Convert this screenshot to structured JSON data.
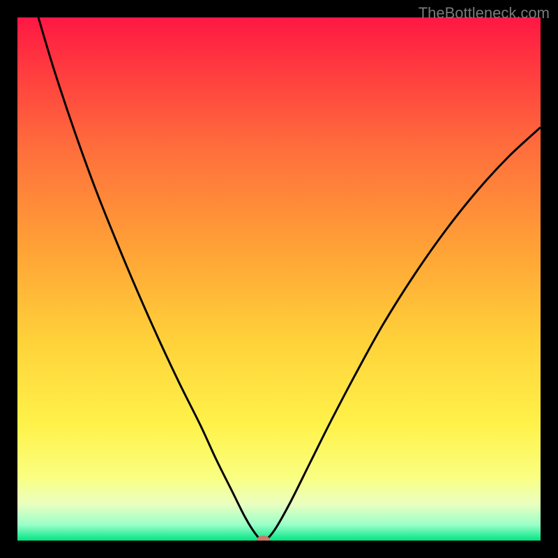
{
  "watermark": "TheBottleneck.com",
  "chart_data": {
    "type": "line",
    "title": "",
    "xlabel": "",
    "ylabel": "",
    "xlim": [
      0,
      100
    ],
    "ylim": [
      0,
      100
    ],
    "background_gradient": {
      "stops": [
        {
          "offset": 0.0,
          "color": "#ff1744"
        },
        {
          "offset": 0.1,
          "color": "#ff3b3f"
        },
        {
          "offset": 0.25,
          "color": "#ff6e3c"
        },
        {
          "offset": 0.45,
          "color": "#ffa436"
        },
        {
          "offset": 0.62,
          "color": "#ffd23a"
        },
        {
          "offset": 0.78,
          "color": "#fff24a"
        },
        {
          "offset": 0.88,
          "color": "#faff82"
        },
        {
          "offset": 0.93,
          "color": "#eaffc0"
        },
        {
          "offset": 0.97,
          "color": "#9affc8"
        },
        {
          "offset": 1.0,
          "color": "#00e584"
        }
      ]
    },
    "series": [
      {
        "name": "bottleneck-curve",
        "type": "line",
        "color": "#000000",
        "points": [
          {
            "x": 4.0,
            "y": 100.0
          },
          {
            "x": 7.0,
            "y": 90.0
          },
          {
            "x": 11.0,
            "y": 78.0
          },
          {
            "x": 15.0,
            "y": 67.0
          },
          {
            "x": 19.0,
            "y": 57.0
          },
          {
            "x": 23.0,
            "y": 47.5
          },
          {
            "x": 27.0,
            "y": 38.5
          },
          {
            "x": 31.0,
            "y": 30.0
          },
          {
            "x": 35.0,
            "y": 22.0
          },
          {
            "x": 38.0,
            "y": 15.5
          },
          {
            "x": 41.0,
            "y": 9.5
          },
          {
            "x": 43.5,
            "y": 4.5
          },
          {
            "x": 45.5,
            "y": 1.3
          },
          {
            "x": 47.0,
            "y": 0.0
          },
          {
            "x": 49.0,
            "y": 1.8
          },
          {
            "x": 52.0,
            "y": 7.0
          },
          {
            "x": 56.0,
            "y": 15.0
          },
          {
            "x": 60.0,
            "y": 23.0
          },
          {
            "x": 65.0,
            "y": 32.5
          },
          {
            "x": 70.0,
            "y": 41.5
          },
          {
            "x": 76.0,
            "y": 51.0
          },
          {
            "x": 82.0,
            "y": 59.5
          },
          {
            "x": 88.0,
            "y": 67.0
          },
          {
            "x": 94.0,
            "y": 73.5
          },
          {
            "x": 100.0,
            "y": 79.0
          }
        ]
      }
    ],
    "marker": {
      "name": "optimal-point",
      "x": 47.0,
      "y": 0.0,
      "color": "#c97a6a",
      "rx": 10,
      "ry": 7
    }
  }
}
